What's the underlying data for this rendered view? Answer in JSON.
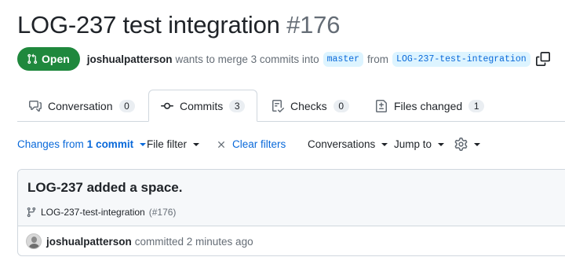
{
  "pr": {
    "title": "LOG-237 test integration",
    "number": "#176",
    "status": "Open",
    "author": "joshualpatterson",
    "merge_text": "wants to merge 3 commits into",
    "base_branch": "master",
    "from_text": "from",
    "head_branch": "LOG-237-test-integration"
  },
  "tabs": [
    {
      "label": "Conversation",
      "count": "0",
      "icon": "comment-discussion-icon"
    },
    {
      "label": "Commits",
      "count": "3",
      "icon": "git-commit-icon"
    },
    {
      "label": "Checks",
      "count": "0",
      "icon": "checklist-icon"
    },
    {
      "label": "Files changed",
      "count": "1",
      "icon": "file-diff-icon"
    }
  ],
  "filters": {
    "changes_prefix": "Changes from",
    "changes_value": "1 commit",
    "file_filter": "File filter",
    "clear_filters": "Clear filters",
    "conversations": "Conversations",
    "jump_to": "Jump to"
  },
  "commit": {
    "message": "LOG-237 added a space.",
    "branch": "LOG-237-test-integration",
    "pr_ref": "(#176)",
    "author": "joshualpatterson",
    "action": "committed 2 minutes ago"
  },
  "colors": {
    "open_green": "#1f883d",
    "link_blue": "#0969da",
    "branch_bg": "#ddf4ff",
    "border": "#d0d7de"
  }
}
